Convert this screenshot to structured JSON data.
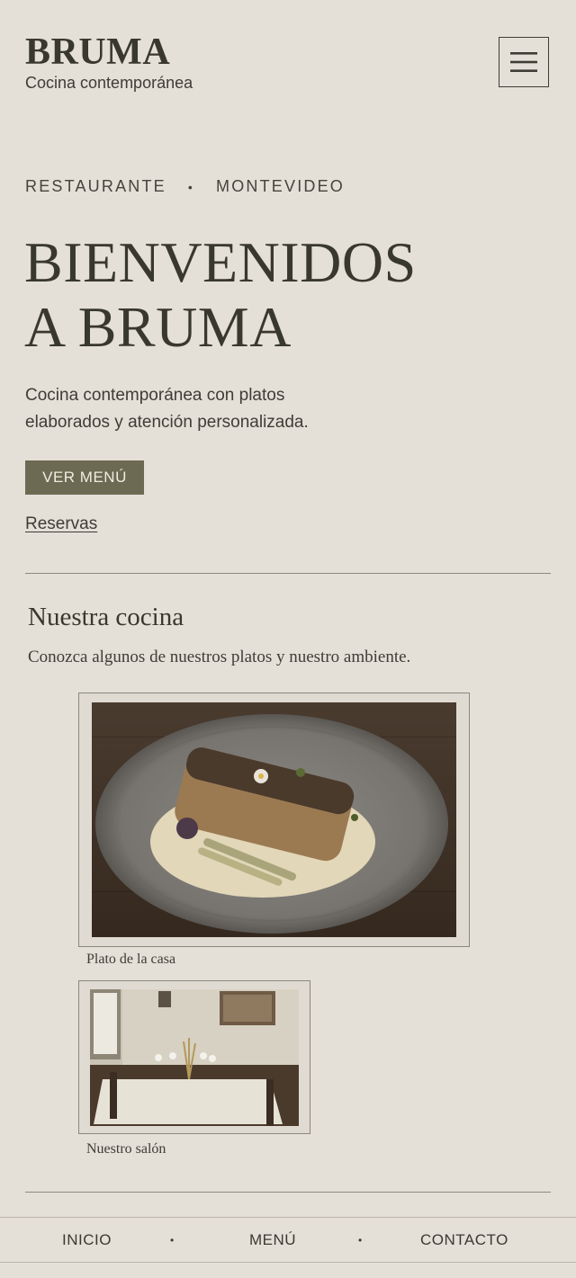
{
  "header": {
    "brand": "BRUMA",
    "tagline": "Cocina contemporánea",
    "menu_icon": "hamburger-menu-icon"
  },
  "hero": {
    "eyebrow_left": "RESTAURANTE",
    "eyebrow_separator": "•",
    "eyebrow_right": "MONTEVIDEO",
    "title_line1": "BIENVENIDOS",
    "title_line2": "A BRUMA",
    "description": "Cocina contemporánea con platos elaborados y atención personalizada.",
    "cta_label": "VER MENÚ",
    "link_label": "Reservas"
  },
  "gallery": {
    "title": "Nuestra cocina",
    "subtitle": "Conozca algunos de nuestros platos y nuestro ambiente.",
    "items": [
      {
        "caption": "Plato de la casa"
      },
      {
        "caption": "Nuestro salón"
      }
    ]
  },
  "bottom_nav": {
    "items": [
      "INICIO",
      "MENÚ",
      "CONTACTO"
    ],
    "separator": "•"
  },
  "colors": {
    "background": "#e4dfd7",
    "text": "#3b3a33",
    "accent": "#6c6a52"
  }
}
